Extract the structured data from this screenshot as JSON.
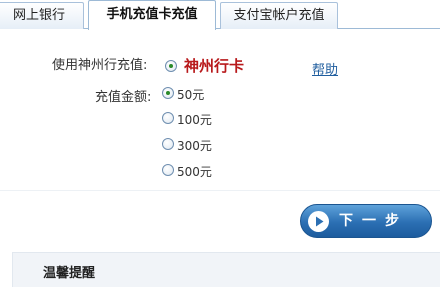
{
  "tabs": [
    {
      "label": "网上银行",
      "active": false
    },
    {
      "label": "手机充值卡充值",
      "active": true
    },
    {
      "label": "支付宝帐户充值",
      "active": false
    }
  ],
  "form": {
    "bank_label": "使用神州行充值:",
    "bank_option": "神州行卡",
    "bank_selected": true,
    "help_link": "帮助",
    "amount_label": "充值金额:",
    "amounts": [
      {
        "label": "50元",
        "selected": true
      },
      {
        "label": "100元",
        "selected": false
      },
      {
        "label": "300元",
        "selected": false
      },
      {
        "label": "500元",
        "selected": false
      }
    ]
  },
  "next_button": {
    "label": "下一步",
    "icon": "play-arrow-icon"
  },
  "notice": {
    "title": "温馨提醒"
  },
  "colors": {
    "tab_border": "#9dbad6",
    "bank_name": "#b8191b",
    "link": "#1f5d9e",
    "button_blue": "#2b6fb3",
    "radio_dot": "#2a8a2a",
    "notice_bg": "#f1f4f8"
  }
}
